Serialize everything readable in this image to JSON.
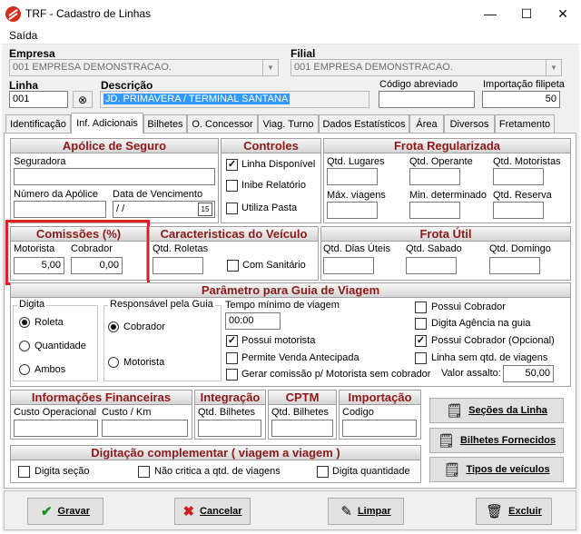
{
  "window": {
    "title": "TRF - Cadastro de Linhas",
    "minimize_glyph": "—",
    "maximize_glyph": "☐",
    "close_glyph": "✕"
  },
  "menu": {
    "saida": "Saída"
  },
  "header": {
    "empresa_label": "Empresa",
    "empresa_value": "001 EMPRESA DEMONSTRACAO.",
    "filial_label": "Filial",
    "filial_value": "001 EMPRESA DEMONSTRACAO.",
    "linha_label": "Linha",
    "linha_value": "001",
    "descricao_label": "Descrição",
    "descricao_value": "JD. PRIMAVERA / TERMINAL SANTANA",
    "codigo_abreviado_label": "Código abreviado",
    "codigo_abreviado_value": "",
    "importacao_label": "Importação filipeta",
    "importacao_value": "50"
  },
  "tabs": [
    {
      "label": "Identificação"
    },
    {
      "label": "Inf. Adicionais"
    },
    {
      "label": "Bilhetes"
    },
    {
      "label": "O. Concessor"
    },
    {
      "label": "Viag. Turno"
    },
    {
      "label": "Dados Estatísticos"
    },
    {
      "label": "Área"
    },
    {
      "label": "Diversos"
    },
    {
      "label": "Fretamento"
    }
  ],
  "apolice": {
    "title": "Apólice de Seguro",
    "seguradora_label": "Seguradora",
    "seguradora_value": "",
    "numero_label": "Número da Apólice",
    "numero_value": "",
    "data_label": "Data de Vencimento",
    "data_value": " /  /",
    "cal_glyph": "15"
  },
  "controles": {
    "title": "Controles",
    "linha_disponivel": "Linha Disponível",
    "inibe_relatorio": "Inibe Relatório",
    "utiliza_pasta": "Utiliza Pasta"
  },
  "frota_reg": {
    "title": "Frota Regularizada",
    "qtd_lugares": "Qtd. Lugares",
    "qtd_operante": "Qtd. Operante",
    "qtd_motoristas": "Qtd. Motoristas",
    "max_viagens": "Máx. viagens",
    "min_determinado": "Min. determinado",
    "qtd_reserva": "Qtd. Reserva"
  },
  "comissoes": {
    "title": "Comissões (%)",
    "motorista_label": "Motorista",
    "motorista_value": "5,00",
    "cobrador_label": "Cobrador",
    "cobrador_value": "0,00"
  },
  "caracteristicas": {
    "title": "Caracteristicas do Veículo",
    "qtd_roletas": "Qtd. Roletas",
    "com_sanitario": "Com Sanitário"
  },
  "frota_util": {
    "title": "Frota Útil",
    "qtd_dias_uteis": "Qtd. Dias Úteis",
    "qtd_sabado": "Qtd. Sabado",
    "qtd_domingo": "Qtd. Domingo"
  },
  "parametro": {
    "title": "Parâmetro para Guia de Viagem",
    "digita_legend": "Digita",
    "roleta": "Roleta",
    "quantidade": "Quantidade",
    "ambos": "Ambos",
    "resp_legend": "Responsável pela Guia",
    "cobrador": "Cobrador",
    "motorista": "Motorista",
    "tempo_label": "Tempo mínimo de viagem",
    "tempo_value": "00:00",
    "possui_motorista": "Possui motorista",
    "permite_venda": "Permite Venda Antecipada",
    "gerar_comissao": "Gerar comissão p/ Motorista sem cobrador",
    "possui_cobrador": "Possui Cobrador",
    "digita_agencia": "Digita Agência na guia",
    "possui_cobrador_opc": "Possui Cobrador (Opcional)",
    "linha_sem": "Linha sem  qtd. de viagens",
    "valor_assalto_label": "Valor assalto:",
    "valor_assalto_value": "50,00"
  },
  "info_fin": {
    "title": "Informações Financeiras",
    "custo_operacional": "Custo Operacional",
    "custo_km": "Custo / Km"
  },
  "integracao": {
    "title": "Integração",
    "qtd_bilhetes": "Qtd. Bilhetes"
  },
  "cptm": {
    "title": "CPTM",
    "qtd_bilhetes": "Qtd. Bilhetes"
  },
  "importacao": {
    "title": "Importação",
    "codigo": "Codigo"
  },
  "side_buttons": {
    "secoes": "Seções da Linha",
    "bilhetes": "Bilhetes Fornecidos",
    "tipos": "Tipos de veículos"
  },
  "digitacao": {
    "title": "Digitação complementar ( viagem a viagem )",
    "digita_secao": "Digita seção",
    "nao_critica": "Não critica a qtd. de  viagens",
    "digita_quantidade": "Digita quantidade"
  },
  "actions": {
    "gravar": "Gravar",
    "cancelar": "Cancelar",
    "limpar": "Limpar",
    "excluir": "Excluir"
  }
}
